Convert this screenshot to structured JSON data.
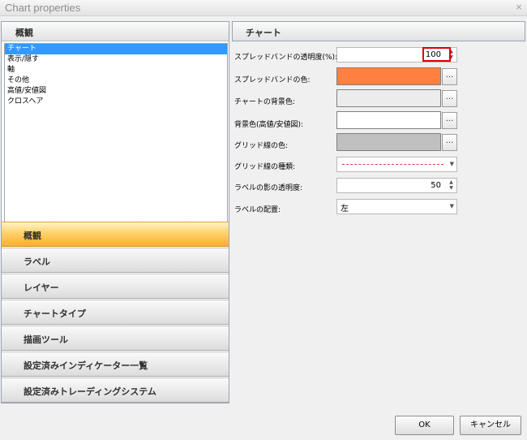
{
  "window": {
    "title": "Chart properties",
    "close_glyph": "×"
  },
  "left_panel": {
    "header": "概観",
    "list_items": [
      {
        "label": "チャート",
        "selected": true
      },
      {
        "label": "表示/隠す",
        "selected": false
      },
      {
        "label": "軸",
        "selected": false
      },
      {
        "label": "その他",
        "selected": false
      },
      {
        "label": "高値/安値図",
        "selected": false
      },
      {
        "label": "クロスヘア",
        "selected": false
      }
    ],
    "nav_sections": [
      {
        "label": "概観",
        "active": true
      },
      {
        "label": "ラベル",
        "active": false
      },
      {
        "label": "レイヤー",
        "active": false
      },
      {
        "label": "チャートタイプ",
        "active": false
      },
      {
        "label": "描画ツール",
        "active": false
      },
      {
        "label": "設定済みインディケーター一覧",
        "active": false
      },
      {
        "label": "設定済みトレーディングシステム",
        "active": false
      }
    ]
  },
  "right_panel": {
    "header": "チャート",
    "properties": {
      "spread_band_transparency": {
        "label": "スプレッドバンドの透明度(%):",
        "value": "100"
      },
      "spread_band_color": {
        "label": "スプレッドバンドの色:",
        "color": "#ff8040"
      },
      "chart_background_color": {
        "label": "チャートの背景色:",
        "color": "#ececec"
      },
      "background_color_hilo": {
        "label": "背景色(高値/安値図):",
        "color": "#ffffff"
      },
      "grid_line_color": {
        "label": "グリッド線の色:",
        "color": "#c0c0c0"
      },
      "grid_line_type": {
        "label": "グリッド線の種類:",
        "line_color": "#d84040"
      },
      "label_shadow_transparency": {
        "label": "ラベルの影の透明度:",
        "value": "50"
      },
      "label_placement": {
        "label": "ラベルの配置:",
        "value": "左"
      }
    },
    "browse_button_label": "..."
  },
  "footer": {
    "ok_label": "OK",
    "cancel_label": "キャンセル"
  }
}
